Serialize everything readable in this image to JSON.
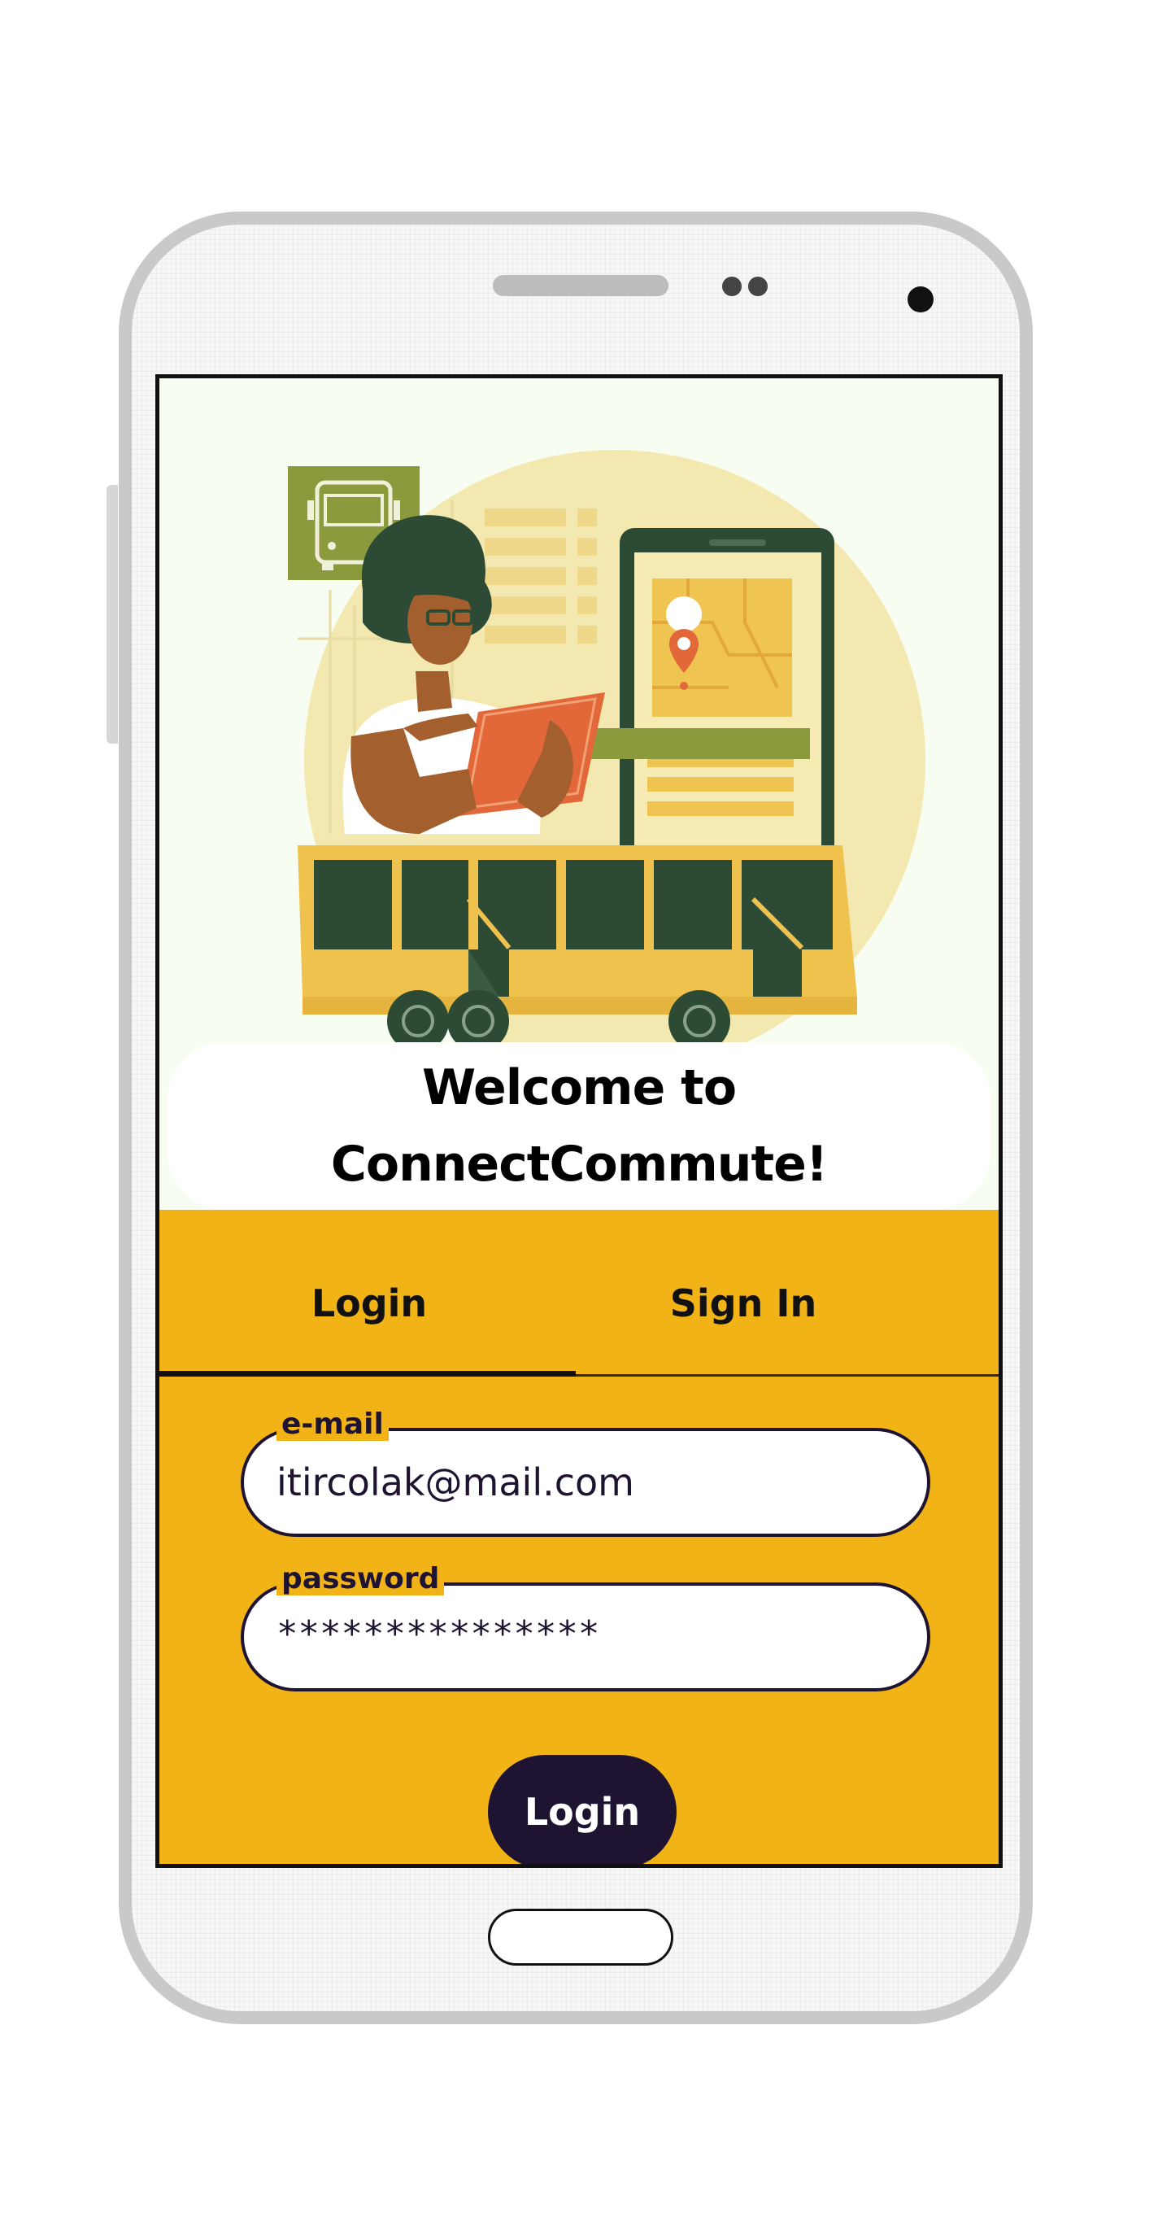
{
  "app": {
    "welcome_title_line1": "Welcome to",
    "welcome_title_line2": "ConnectCommute!"
  },
  "tabs": [
    {
      "label": "Login",
      "active": true
    },
    {
      "label": "Sign In",
      "active": false
    }
  ],
  "form": {
    "email": {
      "label": "e-mail",
      "value": "itircolak@mail.com"
    },
    "password": {
      "label": "password",
      "value": "***************"
    },
    "submit_label": "Login"
  },
  "colors": {
    "accent": "#f2b316",
    "button": "#1e1432",
    "hero_background": "#f7fdf0",
    "bus_yellow": "#efc24e",
    "bus_window": "#2c4a34",
    "olive": "#8c9a3e"
  },
  "illustration": {
    "subject": "woman-with-tablet-bus-map-illustration"
  }
}
